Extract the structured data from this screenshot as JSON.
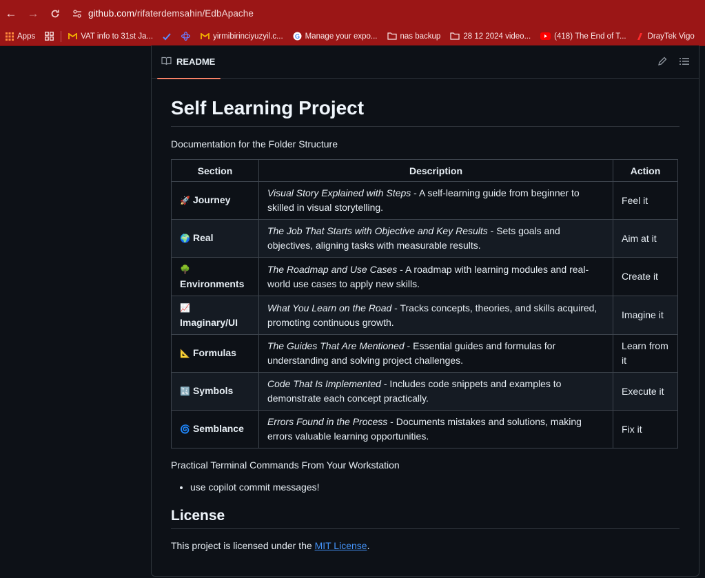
{
  "browser": {
    "url_host": "github.com",
    "url_path": "/rifaterdemsahin/EdbApache",
    "bookmarks": [
      {
        "icon": "apps-grid-icon",
        "label": "Apps"
      },
      {
        "icon": "gmail-icon",
        "label": "VAT info to 31st Ja..."
      },
      {
        "icon": "gmail-icon",
        "label": "yirmibirinciyuzyil.c..."
      },
      {
        "icon": "google-icon",
        "label": "Manage your expo..."
      },
      {
        "icon": "folder-icon",
        "label": "nas backup"
      },
      {
        "icon": "folder-icon",
        "label": "28 12 2024 video..."
      },
      {
        "icon": "youtube-icon",
        "label": "(418) The End of T..."
      },
      {
        "icon": "draytek-icon",
        "label": "DrayTek Vigo"
      }
    ]
  },
  "readme": {
    "tab_label": "README",
    "title": "Self Learning Project",
    "intro": "Documentation for the Folder Structure",
    "table": {
      "headers": [
        "Section",
        "Description",
        "Action"
      ],
      "rows": [
        {
          "emoji": "🚀",
          "section": "Journey",
          "desc_em": "Visual Story Explained with Steps",
          "desc": " - A self-learning guide from beginner to skilled in visual storytelling.",
          "action": "Feel it"
        },
        {
          "emoji": "🌍",
          "section": "Real",
          "desc_em": "The Job That Starts with Objective and Key Results",
          "desc": " - Sets goals and objectives, aligning tasks with measurable results.",
          "action": "Aim at it"
        },
        {
          "emoji": "🌳",
          "section": "Environments",
          "desc_em": "The Roadmap and Use Cases",
          "desc": " - A roadmap with learning modules and real-world use cases to apply new skills.",
          "action": "Create it"
        },
        {
          "emoji": "📈",
          "section": "Imaginary/UI",
          "desc_em": "What You Learn on the Road",
          "desc": " - Tracks concepts, theories, and skills acquired, promoting continuous growth.",
          "action": "Imagine it"
        },
        {
          "emoji": "📐",
          "section": "Formulas",
          "desc_em": "The Guides That Are Mentioned",
          "desc": " - Essential guides and formulas for understanding and solving project challenges.",
          "action": "Learn from it"
        },
        {
          "emoji": "🔣",
          "section": "Symbols",
          "desc_em": "Code That Is Implemented",
          "desc": " - Includes code snippets and examples to demonstrate each concept practically.",
          "action": "Execute it"
        },
        {
          "emoji": "🌀",
          "section": "Semblance",
          "desc_em": "Errors Found in the Process",
          "desc": " - Documents mistakes and solutions, making errors valuable learning opportunities.",
          "action": "Fix it"
        }
      ]
    },
    "commands_heading": "Practical Terminal Commands From Your Workstation",
    "commands": [
      "use copilot commit messages!"
    ],
    "license_heading": "License",
    "license_prefix": "This project is licensed under the ",
    "license_link": "MIT License",
    "license_suffix": "."
  }
}
